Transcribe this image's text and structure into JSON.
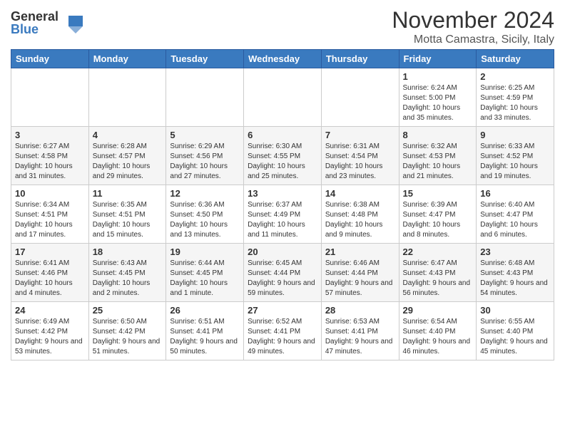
{
  "logo": {
    "general": "General",
    "blue": "Blue"
  },
  "title": "November 2024",
  "subtitle": "Motta Camastra, Sicily, Italy",
  "days_header": [
    "Sunday",
    "Monday",
    "Tuesday",
    "Wednesday",
    "Thursday",
    "Friday",
    "Saturday"
  ],
  "weeks": [
    [
      {
        "day": "",
        "info": ""
      },
      {
        "day": "",
        "info": ""
      },
      {
        "day": "",
        "info": ""
      },
      {
        "day": "",
        "info": ""
      },
      {
        "day": "",
        "info": ""
      },
      {
        "day": "1",
        "info": "Sunrise: 6:24 AM\nSunset: 5:00 PM\nDaylight: 10 hours and 35 minutes."
      },
      {
        "day": "2",
        "info": "Sunrise: 6:25 AM\nSunset: 4:59 PM\nDaylight: 10 hours and 33 minutes."
      }
    ],
    [
      {
        "day": "3",
        "info": "Sunrise: 6:27 AM\nSunset: 4:58 PM\nDaylight: 10 hours and 31 minutes."
      },
      {
        "day": "4",
        "info": "Sunrise: 6:28 AM\nSunset: 4:57 PM\nDaylight: 10 hours and 29 minutes."
      },
      {
        "day": "5",
        "info": "Sunrise: 6:29 AM\nSunset: 4:56 PM\nDaylight: 10 hours and 27 minutes."
      },
      {
        "day": "6",
        "info": "Sunrise: 6:30 AM\nSunset: 4:55 PM\nDaylight: 10 hours and 25 minutes."
      },
      {
        "day": "7",
        "info": "Sunrise: 6:31 AM\nSunset: 4:54 PM\nDaylight: 10 hours and 23 minutes."
      },
      {
        "day": "8",
        "info": "Sunrise: 6:32 AM\nSunset: 4:53 PM\nDaylight: 10 hours and 21 minutes."
      },
      {
        "day": "9",
        "info": "Sunrise: 6:33 AM\nSunset: 4:52 PM\nDaylight: 10 hours and 19 minutes."
      }
    ],
    [
      {
        "day": "10",
        "info": "Sunrise: 6:34 AM\nSunset: 4:51 PM\nDaylight: 10 hours and 17 minutes."
      },
      {
        "day": "11",
        "info": "Sunrise: 6:35 AM\nSunset: 4:51 PM\nDaylight: 10 hours and 15 minutes."
      },
      {
        "day": "12",
        "info": "Sunrise: 6:36 AM\nSunset: 4:50 PM\nDaylight: 10 hours and 13 minutes."
      },
      {
        "day": "13",
        "info": "Sunrise: 6:37 AM\nSunset: 4:49 PM\nDaylight: 10 hours and 11 minutes."
      },
      {
        "day": "14",
        "info": "Sunrise: 6:38 AM\nSunset: 4:48 PM\nDaylight: 10 hours and 9 minutes."
      },
      {
        "day": "15",
        "info": "Sunrise: 6:39 AM\nSunset: 4:47 PM\nDaylight: 10 hours and 8 minutes."
      },
      {
        "day": "16",
        "info": "Sunrise: 6:40 AM\nSunset: 4:47 PM\nDaylight: 10 hours and 6 minutes."
      }
    ],
    [
      {
        "day": "17",
        "info": "Sunrise: 6:41 AM\nSunset: 4:46 PM\nDaylight: 10 hours and 4 minutes."
      },
      {
        "day": "18",
        "info": "Sunrise: 6:43 AM\nSunset: 4:45 PM\nDaylight: 10 hours and 2 minutes."
      },
      {
        "day": "19",
        "info": "Sunrise: 6:44 AM\nSunset: 4:45 PM\nDaylight: 10 hours and 1 minute."
      },
      {
        "day": "20",
        "info": "Sunrise: 6:45 AM\nSunset: 4:44 PM\nDaylight: 9 hours and 59 minutes."
      },
      {
        "day": "21",
        "info": "Sunrise: 6:46 AM\nSunset: 4:44 PM\nDaylight: 9 hours and 57 minutes."
      },
      {
        "day": "22",
        "info": "Sunrise: 6:47 AM\nSunset: 4:43 PM\nDaylight: 9 hours and 56 minutes."
      },
      {
        "day": "23",
        "info": "Sunrise: 6:48 AM\nSunset: 4:43 PM\nDaylight: 9 hours and 54 minutes."
      }
    ],
    [
      {
        "day": "24",
        "info": "Sunrise: 6:49 AM\nSunset: 4:42 PM\nDaylight: 9 hours and 53 minutes."
      },
      {
        "day": "25",
        "info": "Sunrise: 6:50 AM\nSunset: 4:42 PM\nDaylight: 9 hours and 51 minutes."
      },
      {
        "day": "26",
        "info": "Sunrise: 6:51 AM\nSunset: 4:41 PM\nDaylight: 9 hours and 50 minutes."
      },
      {
        "day": "27",
        "info": "Sunrise: 6:52 AM\nSunset: 4:41 PM\nDaylight: 9 hours and 49 minutes."
      },
      {
        "day": "28",
        "info": "Sunrise: 6:53 AM\nSunset: 4:41 PM\nDaylight: 9 hours and 47 minutes."
      },
      {
        "day": "29",
        "info": "Sunrise: 6:54 AM\nSunset: 4:40 PM\nDaylight: 9 hours and 46 minutes."
      },
      {
        "day": "30",
        "info": "Sunrise: 6:55 AM\nSunset: 4:40 PM\nDaylight: 9 hours and 45 minutes."
      }
    ]
  ]
}
